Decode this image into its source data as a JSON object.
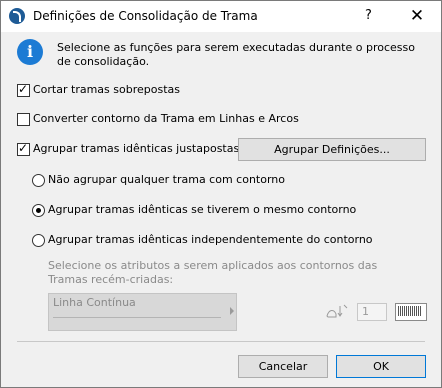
{
  "window": {
    "title": "Definições de Consolidação de Trama",
    "help_label": "?",
    "close_label": "✕"
  },
  "info": {
    "text": "Selecione as funções para serem executadas durante o processo de consolidação."
  },
  "options": {
    "cut_overlapping": {
      "label": "Cortar tramas sobrepostas",
      "checked": true
    },
    "convert_contour": {
      "label": "Converter contorno da Trama em Linhas e Arcos",
      "checked": false
    },
    "group_identical": {
      "label": "Agrupar tramas idênticas justapostas",
      "checked": true
    }
  },
  "group_settings_button": "Agrupar Definições...",
  "grouping_mode": {
    "options": [
      {
        "label": "Não agrupar qualquer trama com contorno",
        "selected": false
      },
      {
        "label": "Agrupar tramas idênticas se tiverem o mesmo contorno",
        "selected": true
      },
      {
        "label": "Agrupar tramas idênticas independentemente do contorno",
        "selected": false
      }
    ]
  },
  "attributes": {
    "instruction": "Selecione os atributos a serem aplicados aos contornos das Tramas recém-criadas:",
    "line_type": "Linha Contínua",
    "pen_number": "1",
    "pen_icon": "pen-weight-icon",
    "pattern_icon": "fill-pattern-icon"
  },
  "footer": {
    "cancel_label": "Cancelar",
    "ok_label": "OK"
  },
  "colors": {
    "info_blue": "#1c7bd4",
    "dialog_bg": "#f0f0f0",
    "disabled_text": "#8a8a8a"
  }
}
